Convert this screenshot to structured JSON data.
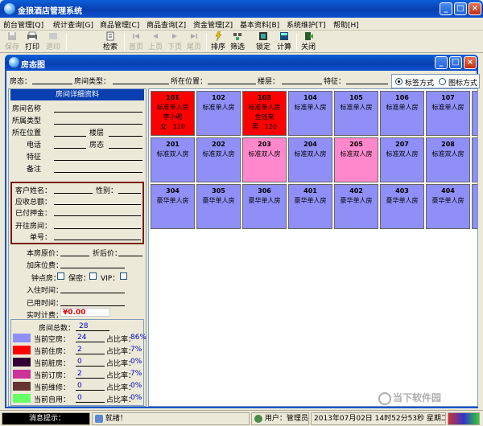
{
  "window": {
    "title": "金狼酒店管理系统"
  },
  "menu": [
    "前台管理[Q]",
    "统计查询[G]",
    "商品管理[C]",
    "商品查询[Z]",
    "资金管理[Z]",
    "基本资料[B]",
    "系统维护[T]",
    "帮助[H]"
  ],
  "toolbar": {
    "save": "保存",
    "print": "打印",
    "exit_print": "退印",
    "search": "检索",
    "first": "首页",
    "prev": "上页",
    "next": "下页",
    "last": "尾页",
    "sort": "排序",
    "filter": "筛选",
    "lock": "锁定",
    "calc": "计算",
    "close": "关闭"
  },
  "panel": {
    "title": "房态图"
  },
  "filter": {
    "status_label": "房态：",
    "type_label": "房间类型：",
    "location_label": "所在位置：",
    "floor_label": "楼层：",
    "feature_label": "特征：",
    "mode_tag": "标签方式",
    "mode_icon": "图标方式",
    "selected_mode": "标签方式"
  },
  "details": {
    "title": "房间详细资料",
    "room_name": "房间名称",
    "room_type": "所属类型",
    "location": "所在位置",
    "floor": "楼层",
    "phone": "电话",
    "status": "房态",
    "feature": "特征",
    "note": "备注",
    "guest_name": "客户姓名：",
    "gender": "性别：",
    "amount_due": "应收总额：",
    "deposit": "已付押金：",
    "open_room": "开往房间：",
    "bill_no": "单号：",
    "orig_price": "本房原价：",
    "discount_price": "折后价：",
    "extra_fee": "加床位费：",
    "hourly": "钟点房：",
    "secret": "保密：",
    "vip": "VIP：",
    "checkin_time": "入住时间：",
    "used_time": "已用时间：",
    "realtime_fee": "实时计费：",
    "realtime_value": "¥0.00"
  },
  "legend": {
    "total_label": "房间总数：",
    "total": "28",
    "rows": [
      {
        "label": "当前空房：",
        "count": "24",
        "ratio_label": "占比率：",
        "ratio": "86%",
        "color": "#8f8ff7"
      },
      {
        "label": "当前住房：",
        "count": "2",
        "ratio_label": "占比率：",
        "ratio": "7%",
        "color": "#ff0000"
      },
      {
        "label": "当前脏房：",
        "count": "0",
        "ratio_label": "占比率：",
        "ratio": "0%",
        "color": "#330033"
      },
      {
        "label": "当前订房：",
        "count": "2",
        "ratio_label": "占比率：",
        "ratio": "7%",
        "color": "#cc3399"
      },
      {
        "label": "当前维修：",
        "count": "0",
        "ratio_label": "占比率：",
        "ratio": "0%",
        "color": "#663333"
      },
      {
        "label": "当前自用：",
        "count": "0",
        "ratio_label": "占比率：",
        "ratio": "0%",
        "color": "#66ff66"
      }
    ]
  },
  "rooms": [
    {
      "num": "101",
      "type": "标准单人房",
      "guest": "李小明",
      "gender": "女",
      "price": "120",
      "color": "#ff0000"
    },
    {
      "num": "102",
      "type": "标准单人房",
      "color": "#8f8ff7"
    },
    {
      "num": "103",
      "type": "标准单人房",
      "guest": "金钱来",
      "gender": "男",
      "price": "120",
      "color": "#ff0000"
    },
    {
      "num": "104",
      "type": "标准单人房",
      "color": "#8f8ff7"
    },
    {
      "num": "105",
      "type": "标准单人房",
      "color": "#8f8ff7"
    },
    {
      "num": "106",
      "type": "标准单人房",
      "color": "#8f8ff7"
    },
    {
      "num": "107",
      "type": "标准单人房",
      "color": "#8f8ff7"
    },
    {
      "num": "201",
      "type": "标准双人房",
      "color": "#8f8ff7"
    },
    {
      "num": "202",
      "type": "标准双人房",
      "color": "#8f8ff7"
    },
    {
      "num": "203",
      "type": "标准双人房",
      "color": "#ff88cc"
    },
    {
      "num": "204",
      "type": "标准双人房",
      "color": "#8f8ff7"
    },
    {
      "num": "205",
      "type": "标准双人房",
      "color": "#ff88cc"
    },
    {
      "num": "207",
      "type": "标准双人房",
      "color": "#8f8ff7"
    },
    {
      "num": "208",
      "type": "标准双人房",
      "color": "#8f8ff7"
    },
    {
      "num": "304",
      "type": "豪华单人房",
      "color": "#8f8ff7"
    },
    {
      "num": "305",
      "type": "豪华单人房",
      "color": "#8f8ff7"
    },
    {
      "num": "306",
      "type": "豪华单人房",
      "color": "#8f8ff7"
    },
    {
      "num": "401",
      "type": "豪华单人房",
      "color": "#8f8ff7"
    },
    {
      "num": "402",
      "type": "豪华单人房",
      "color": "#8f8ff7"
    },
    {
      "num": "403",
      "type": "豪华单人房",
      "color": "#8f8ff7"
    },
    {
      "num": "404",
      "type": "豪华单人房",
      "color": "#8f8ff7"
    }
  ],
  "status": {
    "msg": "消息提示：",
    "ready": "就绪！",
    "user": "用户：管理员",
    "datetime": "2013年07月02日 14时52分53秒 星期二"
  },
  "watermark": "当下软件园"
}
